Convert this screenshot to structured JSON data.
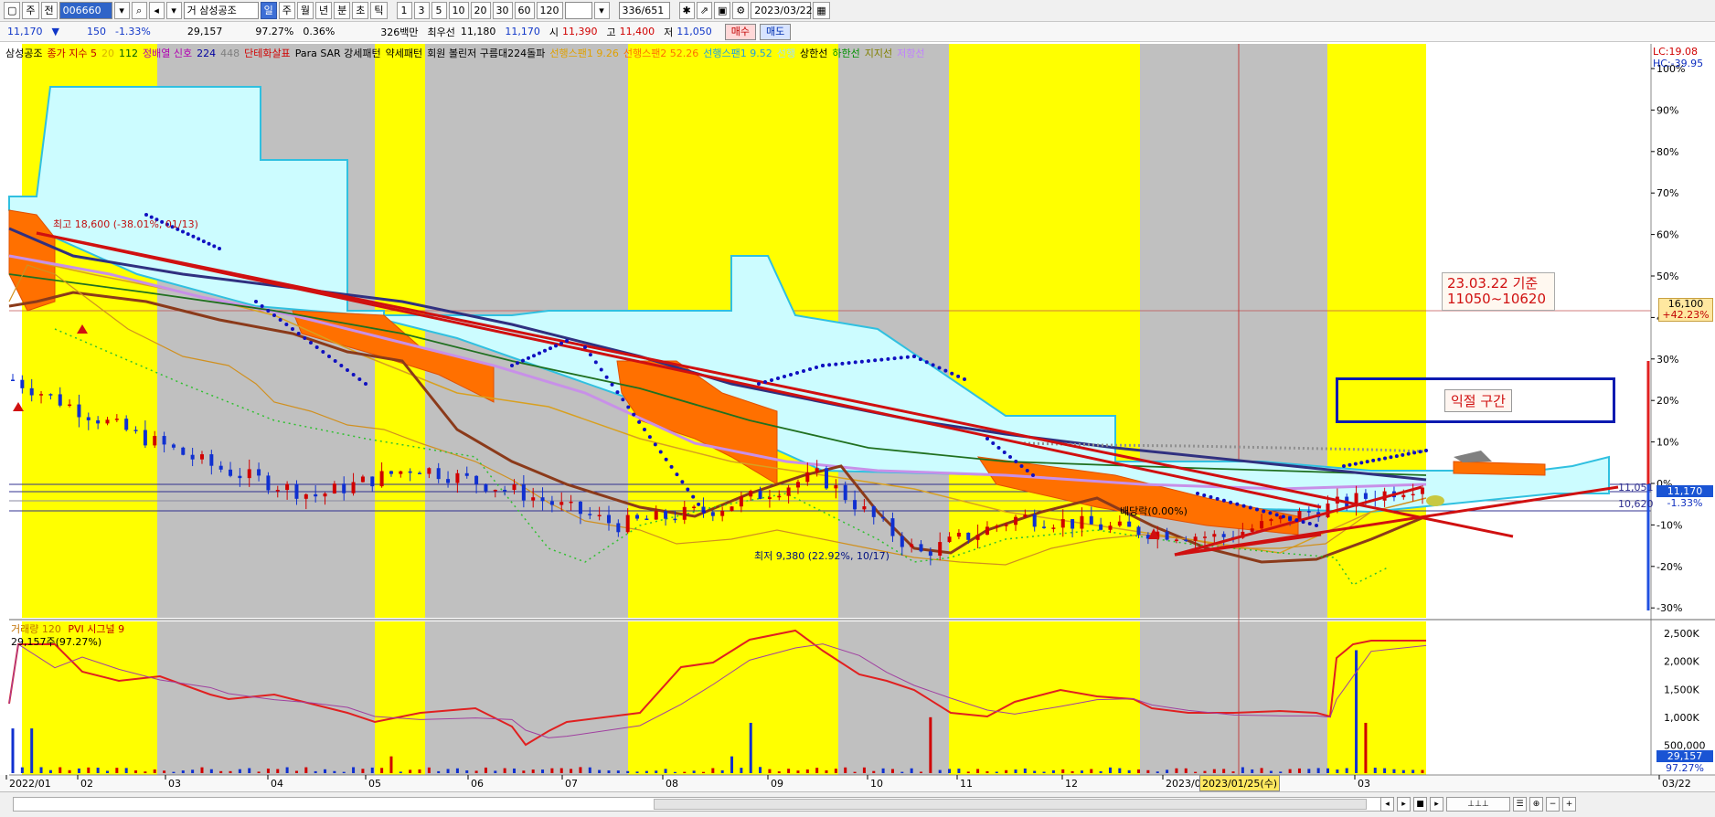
{
  "toolbar": {
    "mode": "주",
    "market": "전",
    "code": "006660",
    "search_label": "거",
    "stock_name": "삼성공조",
    "period_buttons": [
      "일",
      "주",
      "월",
      "년",
      "분",
      "초",
      "틱"
    ],
    "interval_buttons": [
      "1",
      "3",
      "5",
      "10",
      "20",
      "30",
      "60",
      "120"
    ],
    "count": "336",
    "count_total": "/651",
    "date": "2023/03/22"
  },
  "quote": {
    "price": "11,170",
    "change": "150",
    "change_pct": "-1.33%",
    "volume": "29,157",
    "vol_ratio": "97.27%",
    "turnover": "0.36%",
    "amount": "326백만",
    "best_ask_label": "최우선",
    "best_ask": "11,180",
    "best_bid": "11,170",
    "open_label": "시",
    "open": "11,390",
    "high_label": "고",
    "high": "11,400",
    "low_label": "저",
    "low": "11,050",
    "buy_label": "매수",
    "sell_label": "매도"
  },
  "legend": [
    {
      "text": "삼성공조",
      "color": "#000000"
    },
    {
      "text": "종가 지수 5",
      "color": "#c00000"
    },
    {
      "text": "20",
      "color": "#d8b400"
    },
    {
      "text": "112",
      "color": "#006000"
    },
    {
      "text": "정배열 신호",
      "color": "#b000b0"
    },
    {
      "text": "224",
      "color": "#0000a0"
    },
    {
      "text": "448",
      "color": "#808080"
    },
    {
      "text": "단테화살표",
      "color": "#d00000"
    },
    {
      "text": "Para SAR 강세패턴",
      "color": "#000000"
    },
    {
      "text": "약세패턴",
      "color": "#000000"
    },
    {
      "text": "회원 볼린저 구름대224돌파",
      "color": "#000000"
    },
    {
      "text": "선행스팬1 9.26",
      "color": "#e0a000"
    },
    {
      "text": "선행스팬2 52.26",
      "color": "#ff7000"
    },
    {
      "text": "선행스팬1 9.52",
      "color": "#20a0e0"
    },
    {
      "text": "선행",
      "color": "#a0e0ff"
    },
    {
      "text": "상한선",
      "color": "#000000"
    },
    {
      "text": "하한선",
      "color": "#009000"
    },
    {
      "text": "지지선",
      "color": "#808000"
    },
    {
      "text": "저항선",
      "color": "#c080ff"
    }
  ],
  "volume_legend": {
    "title": "거래량 120",
    "pvi": "PVI 시그널 9",
    "value": "29,157주(97.27%)"
  },
  "annotations": {
    "high_text": "최고 18,600 (-38.01%, 01/13)",
    "low_text": "최저 9,380 (22.92%, 10/17)",
    "ex_rights": "배당락(0.00%)",
    "note_line1": "23.03.22 기준",
    "note_line2": "11050~10620",
    "profit_zone": "익절 구간",
    "lc": "LC:19.08",
    "hc": "HC:-39.95",
    "price_tag_top": "16,100",
    "price_tag_top_pct": "+42.23%",
    "price_tag_cur": "11,170",
    "price_tag_cur_pct": "-1.33%",
    "price_level_a": "11,051",
    "price_level_b": "10,620",
    "vol_tag": "29,157",
    "vol_tag_pct": "97.27%",
    "cursor_date": "2023/01/25(수)"
  },
  "colors": {
    "yellow_band": "#ffff00",
    "gray_band": "#c0c0c0",
    "cloud_light": "#ccfcff",
    "cloud_orange": "#ff7000",
    "trend_red": "#d01010",
    "ma_brown": "#8b3a1a",
    "ma_violet": "#c890e8",
    "ma_navy": "#303080",
    "ma_green": "#207020",
    "sar_blue": "#1010c0",
    "up": "#d00000",
    "down": "#1030d0"
  },
  "chart_data": [
    {
      "type": "candlestick",
      "title": "삼성공조",
      "x_ticks": [
        "2022/01",
        "02",
        "03",
        "04",
        "05",
        "06",
        "07",
        "08",
        "09",
        "10",
        "11",
        "12",
        "2023/0",
        "03",
        "03/22"
      ],
      "y_ticks_pct": [
        "100%",
        "90%",
        "80%",
        "70%",
        "60%",
        "50%",
        "40%",
        "30%",
        "20%",
        "10%",
        "0%",
        "-10%",
        "-20%",
        "-30%"
      ],
      "ylim_pct": [
        -30,
        100
      ],
      "close_pct_approx": [
        25,
        14,
        4,
        -3,
        4,
        -2,
        -10,
        -6,
        2,
        -17,
        -8,
        -11,
        -13,
        -6,
        0
      ],
      "high_label": "최고 18,600",
      "low_label": "최저 9,380"
    },
    {
      "type": "bar",
      "title": "거래량 120",
      "y_ticks": [
        "2,500K",
        "2,000K",
        "1,500K",
        "1,000K",
        "500,000"
      ],
      "ylim": [
        0,
        2500000
      ],
      "current": 29157
    }
  ]
}
